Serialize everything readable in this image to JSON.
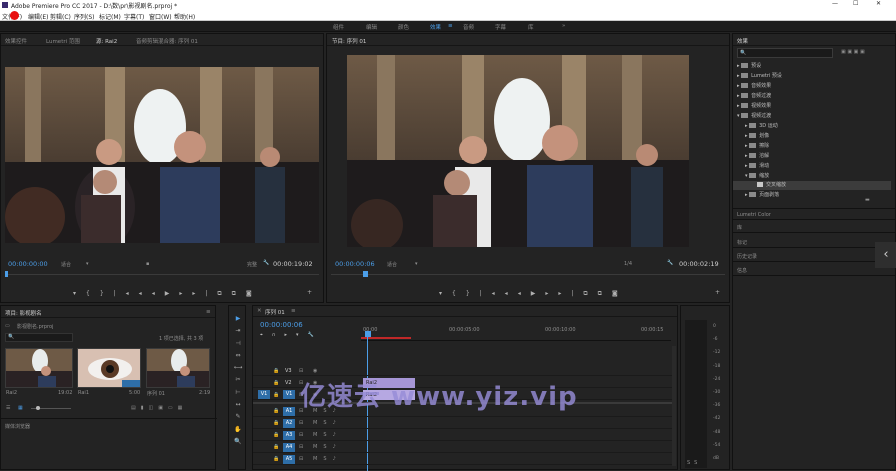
{
  "title_bar": {
    "title": "Adobe Premiere Pro CC 2017 - D:\\数\\pr\\影视剧名.prproj *"
  },
  "menu": [
    "文件(F)",
    "编辑(E)",
    "剪辑(C)",
    "序列(S)",
    "标记(M)",
    "字幕(T)",
    "窗口(W)",
    "帮助(H)"
  ],
  "workspaces": [
    "组件",
    "编辑",
    "颜色",
    "效果",
    "音频",
    "字幕",
    "库",
    "»"
  ],
  "active_workspace": "效果",
  "source_monitor": {
    "tabs": [
      "效果控件",
      "Lumetri 范围",
      "源: Rai2",
      "音频剪辑混合器: 序列 01"
    ],
    "timecode_in": "00:00:00:00",
    "fit": "适合",
    "resolution": "完整",
    "timecode_out": "00:00:19:02"
  },
  "program_monitor": {
    "tabs": [
      "节目: 序列 01"
    ],
    "timecode_in": "00:00:00:06",
    "fit": "适合",
    "resolution": "1/4",
    "timecode_out": "00:00:02:19"
  },
  "effects_panel": {
    "tab": "效果",
    "search_placeholder": "",
    "tree": [
      {
        "label": "预设",
        "indent": 0
      },
      {
        "label": "Lumetri 预设",
        "indent": 0
      },
      {
        "label": "音频效果",
        "indent": 0
      },
      {
        "label": "音频过渡",
        "indent": 0
      },
      {
        "label": "视频效果",
        "indent": 0
      },
      {
        "label": "视频过渡",
        "indent": 0
      },
      {
        "label": "3D 运动",
        "indent": 1
      },
      {
        "label": "划像",
        "indent": 1
      },
      {
        "label": "擦除",
        "indent": 1
      },
      {
        "label": "溶解",
        "indent": 1
      },
      {
        "label": "滑动",
        "indent": 1
      },
      {
        "label": "缩放",
        "indent": 1
      },
      {
        "label": "交叉缩放",
        "indent": 2,
        "selected": true
      },
      {
        "label": "页面剥落",
        "indent": 1
      }
    ],
    "sections": [
      "Lumetri Color",
      "库",
      "标记",
      "历史记录",
      "信息"
    ]
  },
  "project_panel": {
    "tab": "项目: 影视剧名",
    "project_file": "影视剧名.prproj",
    "item_count": "1 项已选择, 共 3 项",
    "clips": [
      {
        "name": "Rai2",
        "duration": "19:02"
      },
      {
        "name": "Rai1",
        "duration": "5:00"
      },
      {
        "name": "序列 01",
        "duration": "2:19"
      }
    ],
    "bottom_label": "媒体浏览器"
  },
  "timeline": {
    "tab": "序列 01",
    "timecode": "00:00:00:06",
    "ruler": [
      "00:00",
      "00:00:05:00",
      "00:00:10:00",
      "00:00:15"
    ],
    "video_tracks": [
      "V3",
      "V2",
      "V1"
    ],
    "audio_tracks": [
      "A1",
      "A2",
      "A3",
      "A4",
      "A5"
    ],
    "clips": [
      {
        "track": "V2",
        "label": "Rai2"
      },
      {
        "track": "V1",
        "label": "Rai2"
      }
    ],
    "meter_scale": [
      "0",
      "-6",
      "-12",
      "-18",
      "-24",
      "-30",
      "-36",
      "-42",
      "-48",
      "-54",
      "dB"
    ]
  },
  "watermark": "亿速云 www.yiz.vip",
  "colors": {
    "accent": "#4c9ee8",
    "clip_video": "#a696d6",
    "record": "#e81010",
    "playhead": "#4c9ee8"
  }
}
